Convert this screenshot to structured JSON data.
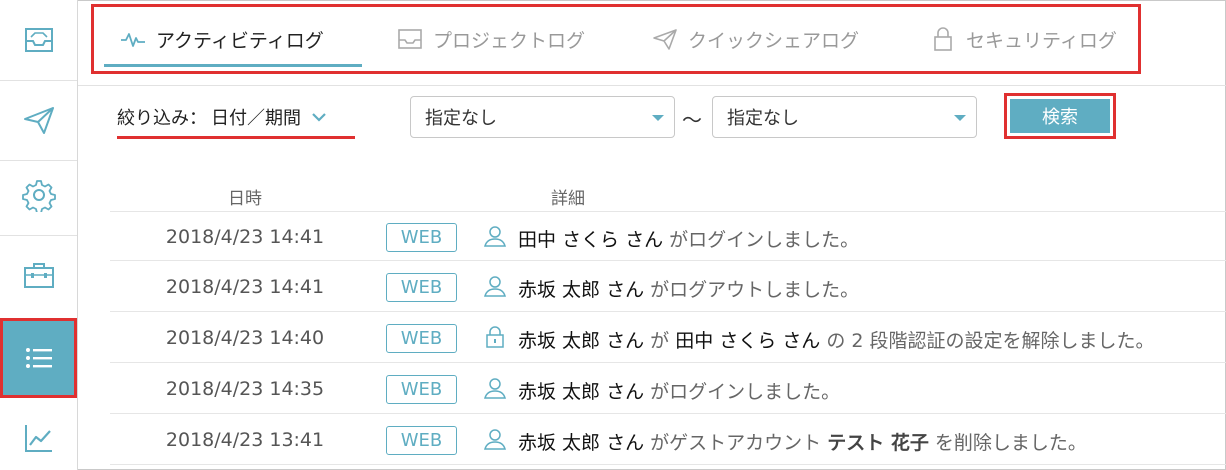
{
  "sidebar": {
    "items": [
      {
        "icon": "inbox-tray-icon"
      },
      {
        "icon": "paper-plane-icon"
      },
      {
        "icon": "gear-icon"
      },
      {
        "icon": "briefcase-icon"
      },
      {
        "icon": "list-icon",
        "active": true
      },
      {
        "icon": "line-chart-icon"
      }
    ]
  },
  "tabs": [
    {
      "label": "アクティビティログ",
      "icon": "pulse-icon",
      "active": true
    },
    {
      "label": "プロジェクトログ",
      "icon": "inbox-tray-icon"
    },
    {
      "label": "クイックシェアログ",
      "icon": "paper-plane-icon"
    },
    {
      "label": "セキュリティログ",
      "icon": "lock-icon"
    }
  ],
  "filter": {
    "label": "絞り込み：",
    "value": "日付／期間",
    "range_separator": "〜",
    "from_value": "指定なし",
    "to_value": "指定なし",
    "search_label": "検索"
  },
  "table": {
    "headers": {
      "datetime": "日時",
      "detail": "詳細"
    },
    "rows": [
      {
        "date": "2018/4/23 14:41",
        "channel": "WEB",
        "icon": "person-icon",
        "user": "田中 さくら さん",
        "action": "がログインしました。"
      },
      {
        "date": "2018/4/23 14:41",
        "channel": "WEB",
        "icon": "person-icon",
        "user": "赤坂 太郎 さん",
        "action": "がログアウトしました。"
      },
      {
        "date": "2018/4/23 14:40",
        "channel": "WEB",
        "icon": "lock-icon",
        "user": "赤坂 太郎 さん",
        "mid": "が",
        "target": "田中 さくら さん",
        "action": "の 2 段階認証の設定を解除しました。"
      },
      {
        "date": "2018/4/23 14:35",
        "channel": "WEB",
        "icon": "person-icon",
        "user": "赤坂 太郎 さん",
        "action": "がログインしました。"
      },
      {
        "date": "2018/4/23 13:41",
        "channel": "WEB",
        "icon": "person-icon",
        "user": "赤坂 太郎 さん",
        "mid": "がゲストアカウント",
        "guest": "テスト 花子",
        "action": "を削除しました。"
      }
    ]
  },
  "colors": {
    "accent": "#5fadc2",
    "highlight": "#e03030"
  }
}
